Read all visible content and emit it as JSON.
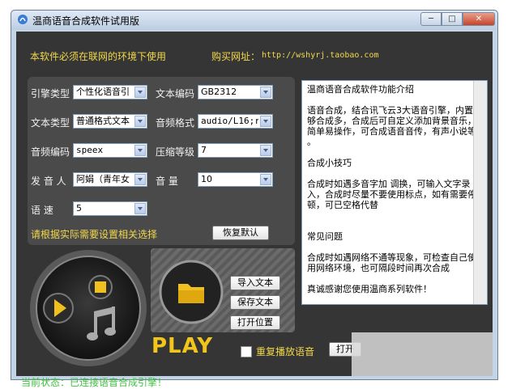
{
  "window": {
    "title": "温商语音合成软件试用版",
    "buttons": {
      "minimize": "─",
      "maximize": "□",
      "close": "✕"
    }
  },
  "header": {
    "notice": "本软件必须在联网的环境下使用",
    "buy_label": "购买网址：",
    "buy_url": "http://wshyrj.taobao.com"
  },
  "settings": {
    "engine_type": {
      "label": "引擎类型",
      "value": "个性化语音引"
    },
    "text_encoding": {
      "label": "文本编码",
      "value": "GB2312"
    },
    "text_type": {
      "label": "文本类型",
      "value": "普通格式文本"
    },
    "audio_format": {
      "label": "音频格式",
      "value": "audio/L16;ra"
    },
    "audio_codec": {
      "label": "音频编码",
      "value": "speex"
    },
    "compression": {
      "label": "压缩等级",
      "value": "7"
    },
    "speaker": {
      "label": "发 音 人",
      "value": "阿娟（青年女"
    },
    "volume": {
      "label": "音    量",
      "value": "10"
    },
    "speed": {
      "label": "语    速",
      "value": "5"
    },
    "hint": "请根据实际需要设置相关选择",
    "reset_button": "恢复默认"
  },
  "info": {
    "text": "温商语音合成软件功能介绍\n\n语音合成，结合讯飞云3大语音引擎，内置能够合成多，合成后可自定义添加背景音乐，简单易操作，可合成语音音传，有声小说等 。\n\n合成小技巧\n\n合成时如遇多音字加 调换，可输入文字录入，合成时尽量不要使用标点，如有需要停顿，可已空格代替\n\n\n常见问题\n\n合成时如遇网络不通等现象，可检查自己使用网络环境，也可隔段时间再次合成\n\n真诚感谢您使用温商系列软件！"
  },
  "actions": {
    "import_text": "导入文本",
    "save_text": "保存文本",
    "open_location": "打开位置",
    "play_logo": "PLAY",
    "repeat_label": "重复播放语音",
    "open_button": "打开"
  },
  "status": {
    "text": "当前状态：已连接语音合成引擎！"
  },
  "colors": {
    "accent_yellow": "#f2d84a",
    "status_green": "#3fc23f",
    "dark_bg": "#353535",
    "panel_bg": "#4a4a4a"
  }
}
